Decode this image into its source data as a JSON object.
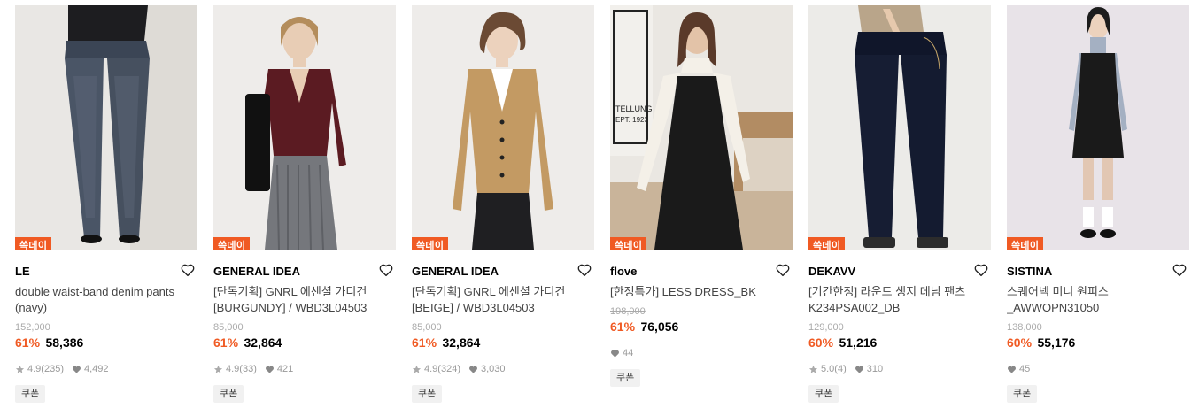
{
  "products": [
    {
      "badge": "쓱데이",
      "brand": "LE",
      "name": "double waist-band denim pants (navy)",
      "original_price": "152,000",
      "discount": "61%",
      "price": "58,386",
      "rating": "4.9",
      "reviews": "(235)",
      "likes": "4,492",
      "coupon": "쿠폰",
      "icon": "product-photo-denim-pants"
    },
    {
      "badge": "쓱데이",
      "brand": "GENERAL IDEA",
      "name": "[단독기획] GNRL 에센셜 가디건 [BURGUNDY] / WBD3L04503",
      "original_price": "85,000",
      "discount": "61%",
      "price": "32,864",
      "rating": "4.9",
      "reviews": "(33)",
      "likes": "421",
      "coupon": "쿠폰",
      "icon": "product-photo-burgundy-cardigan"
    },
    {
      "badge": "쓱데이",
      "brand": "GENERAL IDEA",
      "name": "[단독기획] GNRL 에센셜 가디건 [BEIGE] / WBD3L04503",
      "original_price": "85,000",
      "discount": "61%",
      "price": "32,864",
      "rating": "4.9",
      "reviews": "(324)",
      "likes": "3,030",
      "coupon": "쿠폰",
      "icon": "product-photo-beige-cardigan"
    },
    {
      "badge": "쓱데이",
      "brand": "flove",
      "name": "[한정특가] LESS DRESS_BK",
      "original_price": "198,000",
      "discount": "61%",
      "price": "76,056",
      "rating": "",
      "reviews": "",
      "likes": "44",
      "coupon": "쿠폰",
      "icon": "product-photo-black-dress"
    },
    {
      "badge": "쓱데이",
      "brand": "DEKAVV",
      "name": "[기간한정] 라운드 생지 데님 팬츠 K234PSA002_DB",
      "original_price": "129,000",
      "discount": "60%",
      "price": "51,216",
      "rating": "5.0",
      "reviews": "(4)",
      "likes": "310",
      "coupon": "쿠폰",
      "icon": "product-photo-raw-denim"
    },
    {
      "badge": "쓱데이",
      "brand": "SISTINA",
      "name": "스퀘어넥 미니 원피스 _AWWOPN31050",
      "original_price": "138,000",
      "discount": "60%",
      "price": "55,176",
      "rating": "",
      "reviews": "",
      "likes": "45",
      "coupon": "쿠폰",
      "icon": "product-photo-mini-dress"
    }
  ],
  "colors": {
    "accent": "#f05a23",
    "muted": "#999999",
    "strike": "#aaaaaa"
  }
}
